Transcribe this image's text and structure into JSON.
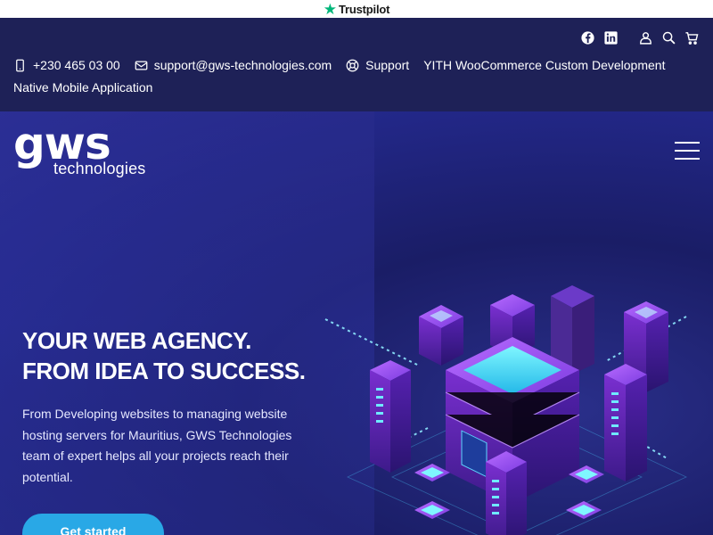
{
  "trustbar": {
    "label": "Trustpilot",
    "star_color": "#00b67a"
  },
  "topbar": {
    "icons": [
      "facebook-icon",
      "linkedin-icon",
      "user-icon",
      "search-icon",
      "cart-icon"
    ],
    "phone": "+230 465 03 00",
    "email": "support@gws-technologies.com",
    "support": "Support",
    "woocommerce": "YITH WooCommerce Custom Development",
    "native": "Native Mobile Application"
  },
  "logo": {
    "wordmark": "gws",
    "subtitle": "technologies"
  },
  "hero": {
    "headline_line1": "YOUR WEB AGENCY.",
    "headline_line2": "FROM IDEA TO SUCCESS.",
    "description": "From Developing websites to managing website hosting servers for Mauritius, GWS Technologies team of expert helps all your projects reach their potential.",
    "cta_label": "Get started",
    "accent": "#29a8e6",
    "illustration": "isometric-server-datacenter-illustration"
  }
}
